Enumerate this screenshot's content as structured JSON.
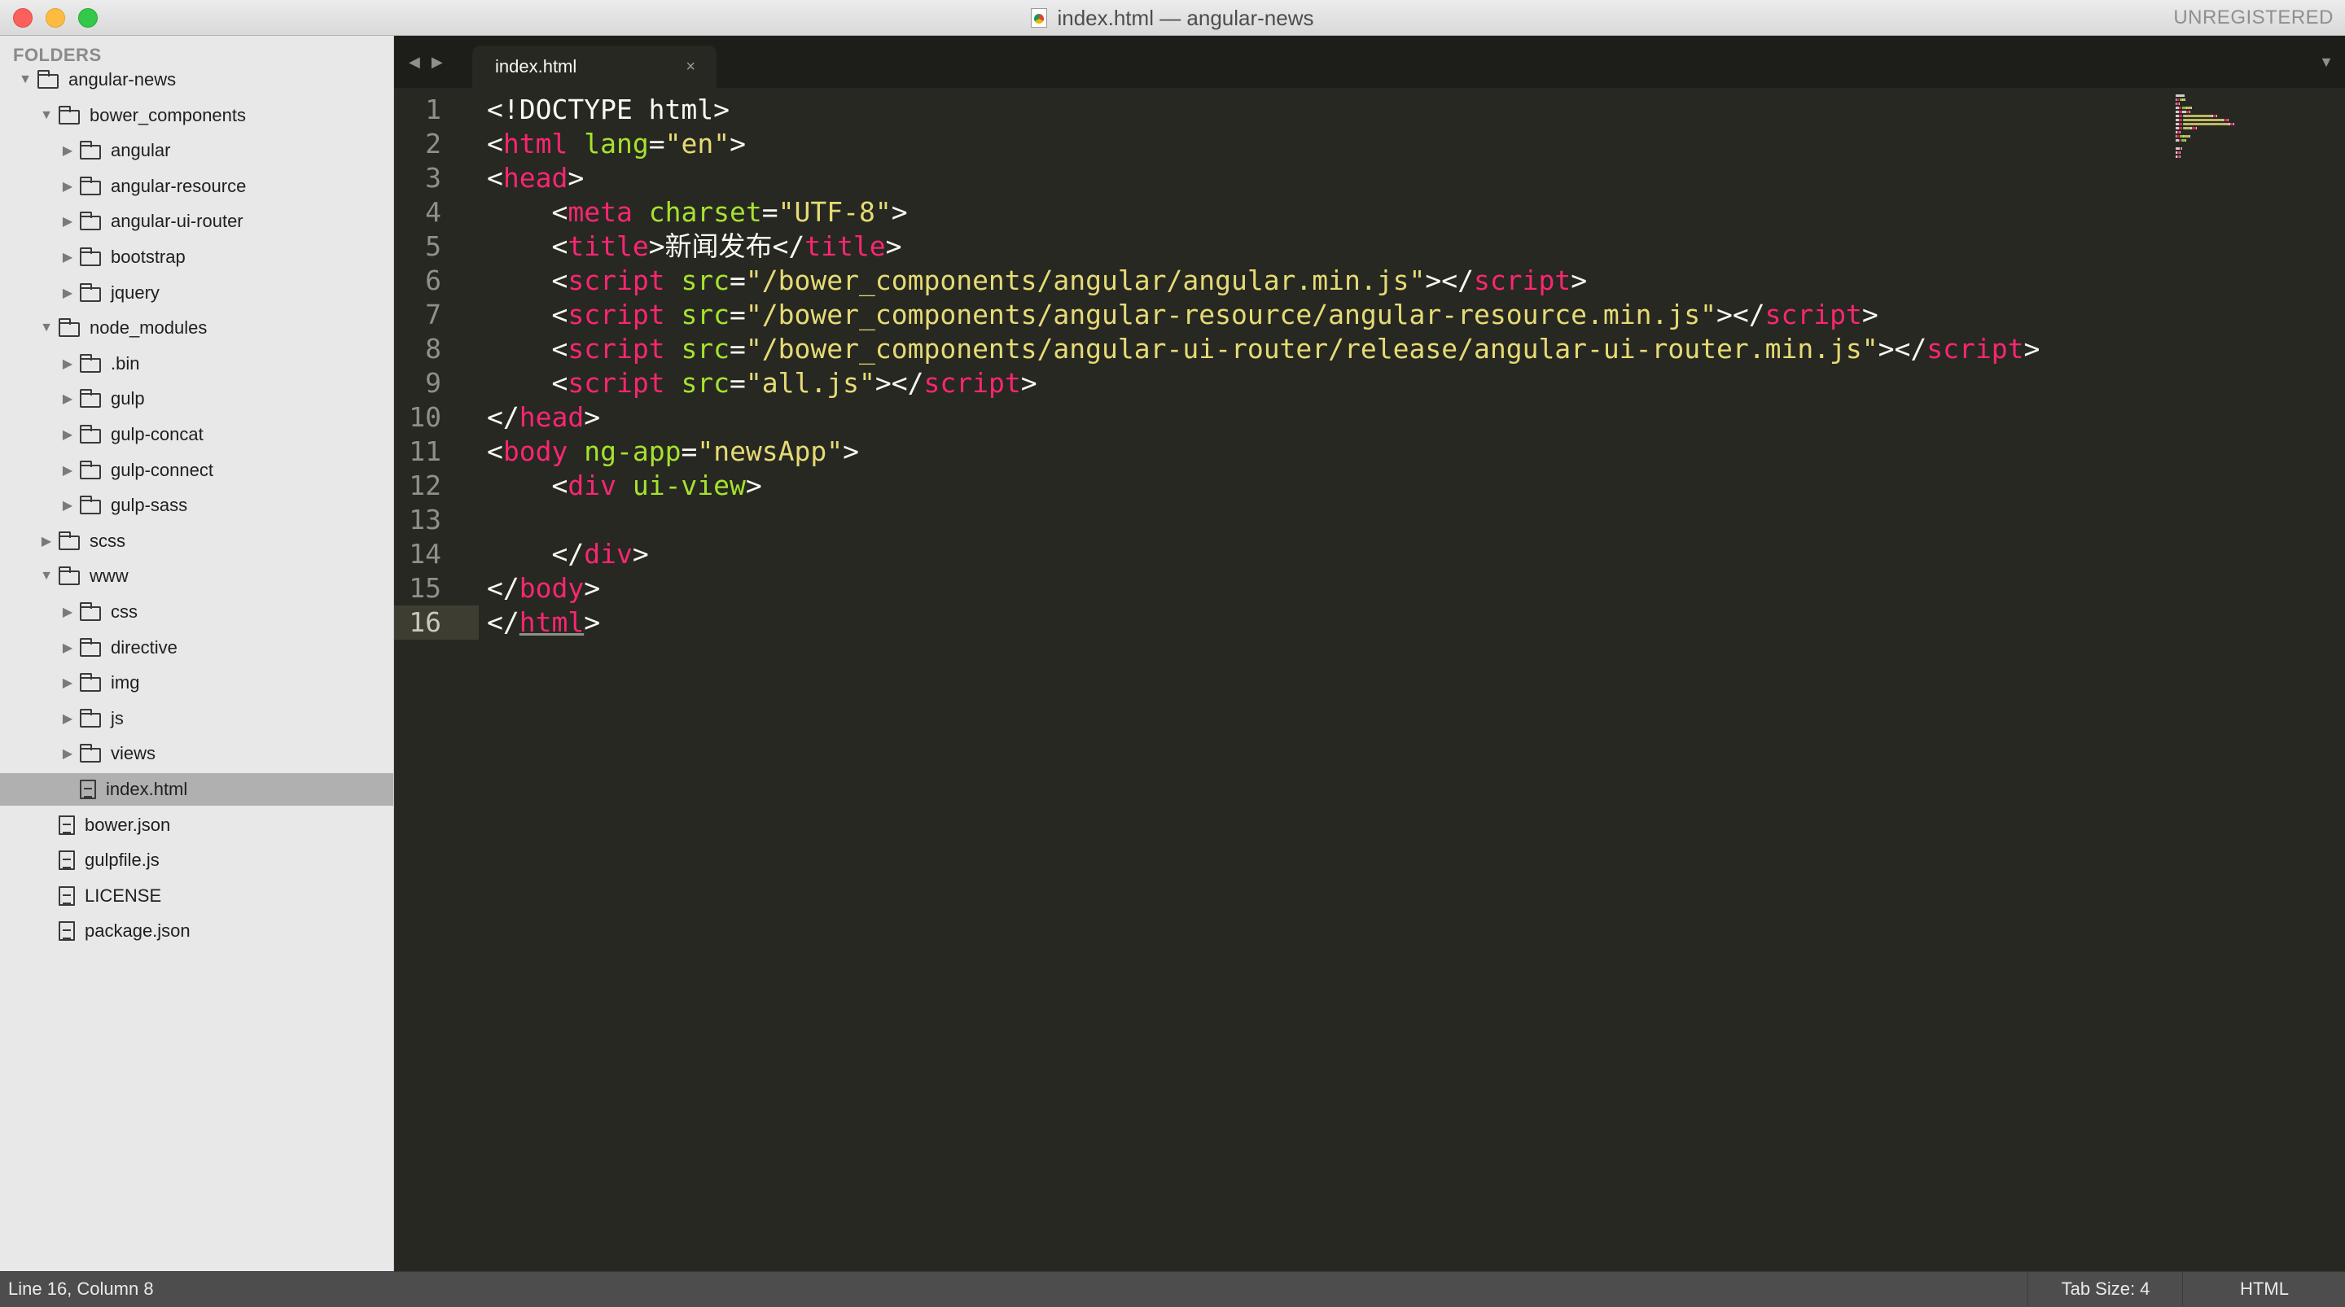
{
  "window": {
    "title": "index.html — angular-news",
    "registration": "UNREGISTERED"
  },
  "sidebar": {
    "header": "FOLDERS",
    "tree": [
      {
        "label": "angular-news",
        "depth": 0,
        "kind": "folder",
        "expanded": true
      },
      {
        "label": "bower_components",
        "depth": 1,
        "kind": "folder",
        "expanded": true
      },
      {
        "label": "angular",
        "depth": 2,
        "kind": "folder",
        "expanded": false
      },
      {
        "label": "angular-resource",
        "depth": 2,
        "kind": "folder",
        "expanded": false
      },
      {
        "label": "angular-ui-router",
        "depth": 2,
        "kind": "folder",
        "expanded": false
      },
      {
        "label": "bootstrap",
        "depth": 2,
        "kind": "folder",
        "expanded": false
      },
      {
        "label": "jquery",
        "depth": 2,
        "kind": "folder",
        "expanded": false
      },
      {
        "label": "node_modules",
        "depth": 1,
        "kind": "folder",
        "expanded": true
      },
      {
        "label": ".bin",
        "depth": 2,
        "kind": "folder",
        "expanded": false
      },
      {
        "label": "gulp",
        "depth": 2,
        "kind": "folder",
        "expanded": false
      },
      {
        "label": "gulp-concat",
        "depth": 2,
        "kind": "folder",
        "expanded": false
      },
      {
        "label": "gulp-connect",
        "depth": 2,
        "kind": "folder",
        "expanded": false
      },
      {
        "label": "gulp-sass",
        "depth": 2,
        "kind": "folder",
        "expanded": false
      },
      {
        "label": "scss",
        "depth": 1,
        "kind": "folder",
        "expanded": false
      },
      {
        "label": "www",
        "depth": 1,
        "kind": "folder",
        "expanded": true
      },
      {
        "label": "css",
        "depth": 2,
        "kind": "folder",
        "expanded": false
      },
      {
        "label": "directive",
        "depth": 2,
        "kind": "folder",
        "expanded": false
      },
      {
        "label": "img",
        "depth": 2,
        "kind": "folder",
        "expanded": false
      },
      {
        "label": "js",
        "depth": 2,
        "kind": "folder",
        "expanded": false
      },
      {
        "label": "views",
        "depth": 2,
        "kind": "folder",
        "expanded": false
      },
      {
        "label": "index.html",
        "depth": 2,
        "kind": "file",
        "selected": true
      },
      {
        "label": "bower.json",
        "depth": 1,
        "kind": "file"
      },
      {
        "label": "gulpfile.js",
        "depth": 1,
        "kind": "file"
      },
      {
        "label": "LICENSE",
        "depth": 1,
        "kind": "file"
      },
      {
        "label": "package.json",
        "depth": 1,
        "kind": "file"
      }
    ]
  },
  "tabs": [
    {
      "label": "index.html",
      "close": "×",
      "active": true
    }
  ],
  "editor": {
    "active_line": 16,
    "lines": [
      [
        [
          "t",
          "<!DOCTYPE html>"
        ]
      ],
      [
        [
          "t",
          "<"
        ],
        [
          "g",
          "html"
        ],
        [
          "t",
          " "
        ],
        [
          "a",
          "lang"
        ],
        [
          "t",
          "="
        ],
        [
          "s",
          "\"en\""
        ],
        [
          "t",
          ">"
        ]
      ],
      [
        [
          "t",
          "<"
        ],
        [
          "g",
          "head"
        ],
        [
          "t",
          ">"
        ]
      ],
      [
        [
          "t",
          "    <"
        ],
        [
          "g",
          "meta"
        ],
        [
          "t",
          " "
        ],
        [
          "a",
          "charset"
        ],
        [
          "t",
          "="
        ],
        [
          "s",
          "\"UTF-8\""
        ],
        [
          "t",
          ">"
        ]
      ],
      [
        [
          "t",
          "    <"
        ],
        [
          "g",
          "title"
        ],
        [
          "t",
          ">新闻发布</"
        ],
        [
          "g",
          "title"
        ],
        [
          "t",
          ">"
        ]
      ],
      [
        [
          "t",
          "    <"
        ],
        [
          "g",
          "script"
        ],
        [
          "t",
          " "
        ],
        [
          "a",
          "src"
        ],
        [
          "t",
          "="
        ],
        [
          "s",
          "\"/bower_components/angular/angular.min.js\""
        ],
        [
          "t",
          "></"
        ],
        [
          "g",
          "script"
        ],
        [
          "t",
          ">"
        ]
      ],
      [
        [
          "t",
          "    <"
        ],
        [
          "g",
          "script"
        ],
        [
          "t",
          " "
        ],
        [
          "a",
          "src"
        ],
        [
          "t",
          "="
        ],
        [
          "s",
          "\"/bower_components/angular-resource/angular-resource.min.js\""
        ],
        [
          "t",
          "></"
        ],
        [
          "g",
          "script"
        ],
        [
          "t",
          ">"
        ]
      ],
      [
        [
          "t",
          "    <"
        ],
        [
          "g",
          "script"
        ],
        [
          "t",
          " "
        ],
        [
          "a",
          "src"
        ],
        [
          "t",
          "="
        ],
        [
          "s",
          "\"/bower_components/angular-ui-router/release/angular-ui-router.min.js\""
        ],
        [
          "t",
          "></"
        ],
        [
          "g",
          "script"
        ],
        [
          "t",
          ">"
        ]
      ],
      [
        [
          "t",
          "    <"
        ],
        [
          "g",
          "script"
        ],
        [
          "t",
          " "
        ],
        [
          "a",
          "src"
        ],
        [
          "t",
          "="
        ],
        [
          "s",
          "\"all.js\""
        ],
        [
          "t",
          "></"
        ],
        [
          "g",
          "script"
        ],
        [
          "t",
          ">"
        ]
      ],
      [
        [
          "t",
          "</"
        ],
        [
          "g",
          "head"
        ],
        [
          "t",
          ">"
        ]
      ],
      [
        [
          "t",
          "<"
        ],
        [
          "g",
          "body"
        ],
        [
          "t",
          " "
        ],
        [
          "a",
          "ng-app"
        ],
        [
          "t",
          "="
        ],
        [
          "s",
          "\"newsApp\""
        ],
        [
          "t",
          ">"
        ]
      ],
      [
        [
          "t",
          "    <"
        ],
        [
          "g",
          "div"
        ],
        [
          "t",
          " "
        ],
        [
          "a",
          "ui-view"
        ],
        [
          "t",
          ">"
        ]
      ],
      [
        [
          "t",
          ""
        ]
      ],
      [
        [
          "t",
          "    </"
        ],
        [
          "g",
          "div"
        ],
        [
          "t",
          ">"
        ]
      ],
      [
        [
          "t",
          "</"
        ],
        [
          "g",
          "body"
        ],
        [
          "t",
          ">"
        ]
      ],
      [
        [
          "t",
          "</"
        ],
        [
          "g",
          "html"
        ],
        [
          "t",
          ">"
        ]
      ]
    ]
  },
  "syntax_colors": {
    "tag": "#f92672",
    "attr": "#a6e22e",
    "string": "#e6db74",
    "text": "#f8f8f2",
    "background": "#272822"
  },
  "statusbar": {
    "position": "Line 16, Column 8",
    "tab_size": "Tab Size: 4",
    "syntax": "HTML"
  }
}
